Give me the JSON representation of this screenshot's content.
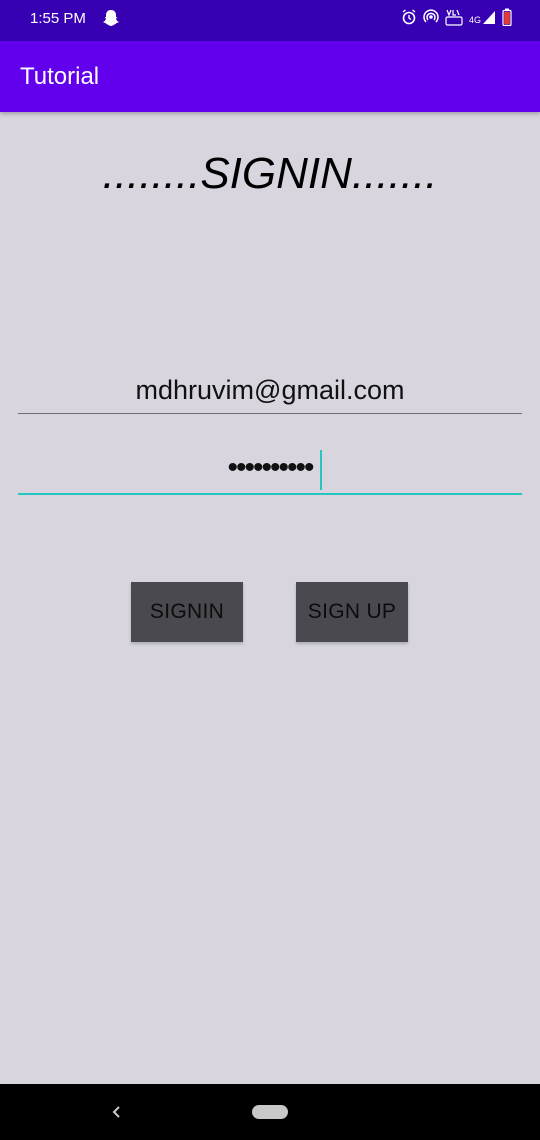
{
  "status_bar": {
    "time": "1:55 PM",
    "left_icon": "snapchat-ghost-icon",
    "right_icons": [
      "alarm-icon",
      "hotspot-icon",
      "volte-icon",
      "4g-signal-icon",
      "battery-icon"
    ],
    "network_label": "4G"
  },
  "app_bar": {
    "title": "Tutorial"
  },
  "screen": {
    "heading": "........SIGNIN......."
  },
  "form": {
    "email_value": "mdhruvim@gmail.com",
    "password_value": "••••••••••"
  },
  "buttons": {
    "signin_label": "SIGNIN",
    "signup_label": "SIGN UP"
  },
  "nav_bar": {
    "icons": [
      "back-icon",
      "home-pill-icon"
    ]
  },
  "colors": {
    "status_bar": "#3700b3",
    "app_bar": "#6200ee",
    "background": "#d8d5df",
    "accent": "#26c6c0",
    "button": "#4a494f"
  }
}
